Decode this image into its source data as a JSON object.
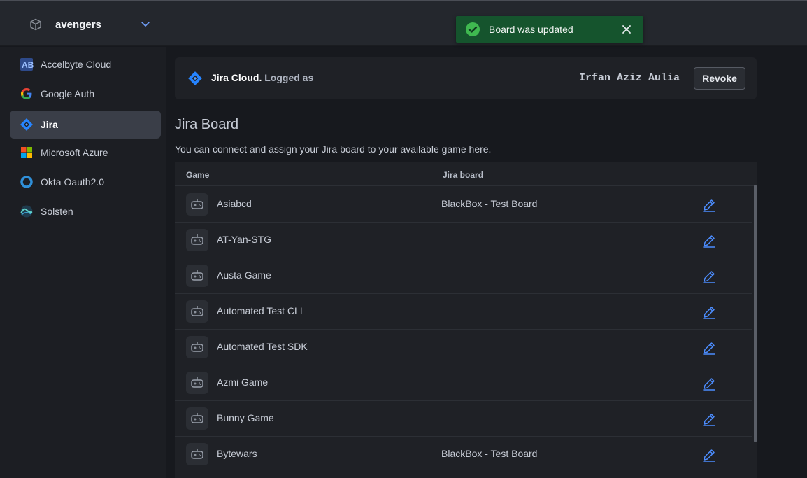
{
  "namespace": {
    "name": "avengers",
    "icon": "cube-icon"
  },
  "sidebar": {
    "items": [
      {
        "label": "Accelbyte Cloud",
        "icon": "accelbyte-icon"
      },
      {
        "label": "Google Auth",
        "icon": "google-icon"
      },
      {
        "label": "Jira",
        "icon": "jira-icon",
        "active": true
      },
      {
        "label": "Microsoft Azure",
        "icon": "microsoft-icon"
      },
      {
        "label": "Okta Oauth2.0",
        "icon": "okta-icon"
      },
      {
        "label": "Solsten",
        "icon": "solsten-icon"
      }
    ]
  },
  "jira_card": {
    "product": "Jira Cloud.",
    "logged_as": "Logged as",
    "user": "Irfan Aziz Aulia",
    "revoke_label": "Revoke"
  },
  "board_section": {
    "title": "Jira Board",
    "description": "You can connect and assign your Jira board to your available game here."
  },
  "table": {
    "headers": {
      "game": "Game",
      "board": "Jira board"
    },
    "rows": [
      {
        "game": "Asiabcd",
        "board": "BlackBox - Test Board"
      },
      {
        "game": "AT-Yan-STG",
        "board": ""
      },
      {
        "game": "Austa Game",
        "board": ""
      },
      {
        "game": "Automated Test CLI",
        "board": ""
      },
      {
        "game": "Automated Test SDK",
        "board": ""
      },
      {
        "game": "Azmi Game",
        "board": ""
      },
      {
        "game": "Bunny Game",
        "board": ""
      },
      {
        "game": "Bytewars",
        "board": "BlackBox - Test Board"
      }
    ]
  },
  "toast": {
    "message": "Board was updated",
    "icon": "check-circle-icon"
  },
  "colors": {
    "accent": "#2684ff",
    "edit_icon": "#4c8dff",
    "toast_bg": "#15542d",
    "toast_check": "#3fb950"
  }
}
